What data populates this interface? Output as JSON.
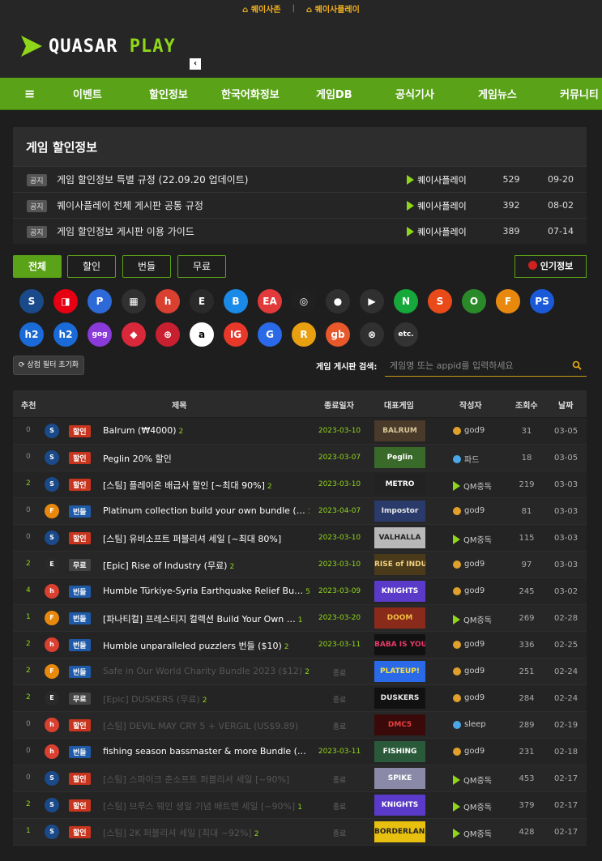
{
  "topbar": {
    "link1": "퀘이사존",
    "separator": "|",
    "link2": "퀘이사플레이"
  },
  "logo": {
    "text_a": "QUASAR ",
    "text_b": "PLAY",
    "collapse": "‹"
  },
  "nav": {
    "menu": "≡",
    "items": [
      "이벤트",
      "할인정보",
      "한국어화정보",
      "게임DB",
      "공식기사",
      "게임뉴스",
      "커뮤니티"
    ]
  },
  "board": {
    "title": "게임 할인정보"
  },
  "notices": [
    {
      "tag": "공지",
      "title": "게임 할인정보 특별 규정 (22.09.20 업데이트)",
      "author": "퀘이사플레이",
      "views": "529",
      "date": "09-20"
    },
    {
      "tag": "공지",
      "title": "퀘이사플레이 전체 게시판 공통 규정",
      "author": "퀘이사플레이",
      "views": "392",
      "date": "08-02"
    },
    {
      "tag": "공지",
      "title": "게임 할인정보 게시판 이용 가이드",
      "author": "퀘이사플레이",
      "views": "389",
      "date": "07-14"
    }
  ],
  "filters": {
    "all": "전체",
    "sale": "할인",
    "bundle": "번들",
    "free": "무료",
    "popular": "인기정보"
  },
  "platforms_row1": [
    {
      "icon": "steam-icon",
      "color": "#1b4a8a",
      "glyph": "S"
    },
    {
      "icon": "nintendo-icon",
      "color": "#e60012",
      "glyph": "◨"
    },
    {
      "icon": "ps-store-icon",
      "color": "#2d6ad8",
      "glyph": "P"
    },
    {
      "icon": "ms-store-icon",
      "color": "#303030",
      "glyph": "▦"
    },
    {
      "icon": "humble-icon",
      "color": "#d94030",
      "glyph": "h"
    },
    {
      "icon": "epic-icon",
      "color": "#2a2a2a",
      "glyph": "E"
    },
    {
      "icon": "battlenet-icon",
      "color": "#1a8ae8",
      "glyph": "B"
    },
    {
      "icon": "ea-icon",
      "color": "#e23a3a",
      "glyph": "EA"
    },
    {
      "icon": "ubisoft-icon",
      "color": "#202020",
      "glyph": "◎"
    },
    {
      "icon": "apple-icon",
      "color": "#303030",
      "glyph": "●"
    },
    {
      "icon": "google-play-icon",
      "color": "#303030",
      "glyph": "▶"
    },
    {
      "icon": "nexon-icon",
      "color": "#16a83a",
      "glyph": "N"
    },
    {
      "icon": "smilegate-icon",
      "color": "#e84a1a",
      "glyph": "S"
    },
    {
      "icon": "onestore-icon",
      "color": "#2a8a2a",
      "glyph": "O"
    },
    {
      "icon": "fanatical-icon",
      "color": "#e8890e",
      "glyph": "F"
    },
    {
      "icon": "ps-plus-icon",
      "color": "#1a5ad8",
      "glyph": "PS"
    }
  ],
  "platforms_row2": [
    {
      "icon": "h2-icon",
      "color": "#1a6ad8",
      "glyph": "h2"
    },
    {
      "icon": "h2-alt-icon",
      "color": "#1a6ad8",
      "glyph": "h2"
    },
    {
      "icon": "gog-icon",
      "color": "#8a3ad8",
      "glyph": "gog"
    },
    {
      "icon": "gamesplanet-icon",
      "color": "#d8283a",
      "glyph": "◆"
    },
    {
      "icon": "indiegala-icon",
      "color": "#c82030",
      "glyph": "⊕"
    },
    {
      "icon": "amazon-icon",
      "color": "#ffffff",
      "glyph": "a"
    },
    {
      "icon": "ig-icon",
      "color": "#e8382a",
      "glyph": "IG"
    },
    {
      "icon": "g-icon",
      "color": "#2a6ae8",
      "glyph": "G"
    },
    {
      "icon": "rockstar-icon",
      "color": "#e8a010",
      "glyph": "R"
    },
    {
      "icon": "gamesbillet-icon",
      "color": "#e8582a",
      "glyph": "gb"
    },
    {
      "icon": "gamersgate-icon",
      "color": "#303030",
      "glyph": "⊗"
    },
    {
      "icon": "etc-icon",
      "color": "#333333",
      "glyph": "etc."
    }
  ],
  "search": {
    "reset": "상점 필터 초기화",
    "label": "게임 게시판 검색:",
    "placeholder": "게임명 또는 appid를 입력하세요"
  },
  "table_head": [
    "추천",
    "제목",
    "종료일자",
    "대표게임",
    "작성자",
    "조회수",
    "날짜"
  ],
  "rows": [
    {
      "rec": "0",
      "platform": "steam",
      "cat": "할인",
      "catType": "sale",
      "title": "Balrum (₩4000)",
      "comments": "2",
      "end": "2023-03-10",
      "thumb": "BALRUM",
      "thumbBg": "#4a3a2a",
      "thumbFg": "#d8c898",
      "author": "god9",
      "avatar": "gold",
      "views": "31",
      "date": "03-05",
      "dim": false
    },
    {
      "rec": "0",
      "platform": "steam",
      "cat": "할인",
      "catType": "sale",
      "title": "Peglin 20% 할인",
      "comments": "",
      "end": "2023-03-07",
      "thumb": "Peglin",
      "thumbBg": "#3a6a2a",
      "thumbFg": "#ffffff",
      "author": "파드",
      "avatar": "blue",
      "views": "18",
      "date": "03-05",
      "dim": false
    },
    {
      "rec": "2",
      "platform": "steam",
      "cat": "할인",
      "catType": "sale",
      "title": "[스팀] 플레이온 배급사 할인 [~최대 90%]",
      "comments": "2",
      "end": "2023-03-10",
      "thumb": "METRO",
      "thumbBg": "#222222",
      "thumbFg": "#ffffff",
      "author": "QM중독",
      "avatar": "tri",
      "views": "219",
      "date": "03-03",
      "dim": false
    },
    {
      "rec": "0",
      "platform": "fanatical",
      "cat": "번들",
      "catType": "bun",
      "title": "Platinum collection build your own bundle (…",
      "comments": "1",
      "end": "2023-04-07",
      "thumb": "Impostor",
      "thumbBg": "#2a3a6a",
      "thumbFg": "#e8e8e8",
      "author": "god9",
      "avatar": "gold",
      "views": "81",
      "date": "03-03",
      "dim": false
    },
    {
      "rec": "0",
      "platform": "steam",
      "cat": "할인",
      "catType": "sale",
      "title": "[스팀] 유비소프트 퍼블리셔 세일 [~최대 80%]",
      "comments": "",
      "end": "2023-03-10",
      "thumb": "VALHALLA",
      "thumbBg": "#b8b8b8",
      "thumbFg": "#222222",
      "author": "QM중독",
      "avatar": "tri",
      "views": "115",
      "date": "03-03",
      "dim": false
    },
    {
      "rec": "2",
      "platform": "epic",
      "cat": "무료",
      "catType": "free",
      "title": "[Epic] Rise of Industry (무료)",
      "comments": "2",
      "end": "2023-03-10",
      "thumb": "RISE of INDUSTRY",
      "thumbBg": "#4a3a1a",
      "thumbFg": "#f0d080",
      "author": "god9",
      "avatar": "gold",
      "views": "97",
      "date": "03-03",
      "dim": false
    },
    {
      "rec": "4",
      "platform": "humble",
      "cat": "번들",
      "catType": "bun",
      "title": "Humble Türkiye-Syria Earthquake Relief Bu…",
      "comments": "5",
      "end": "2023-03-09",
      "thumb": "KNIGHTS",
      "thumbBg": "#5a3ac8",
      "thumbFg": "#ffffff",
      "author": "god9",
      "avatar": "gold",
      "views": "245",
      "date": "03-02",
      "dim": false
    },
    {
      "rec": "1",
      "platform": "fanatical",
      "cat": "번들",
      "catType": "bun",
      "title": "[파나티컬] 프레스티지 컬렉션 Build Your Own …",
      "comments": "1",
      "end": "2023-03-20",
      "thumb": "DOOM",
      "thumbBg": "#8a2a1a",
      "thumbFg": "#f0c040",
      "author": "QM중독",
      "avatar": "tri",
      "views": "269",
      "date": "02-28",
      "dim": false
    },
    {
      "rec": "2",
      "platform": "humble",
      "cat": "번들",
      "catType": "bun",
      "title": "Humble unparalleled puzzlers 번들 ($10)",
      "comments": "2",
      "end": "2023-03-11",
      "thumb": "BABA IS YOU",
      "thumbBg": "#111111",
      "thumbFg": "#e83a6a",
      "author": "god9",
      "avatar": "gold",
      "views": "336",
      "date": "02-25",
      "dim": false
    },
    {
      "rec": "2",
      "platform": "fanatical",
      "cat": "번들",
      "catType": "bun",
      "title": "Safe in Our World Charity Bundle 2023 ($12)",
      "comments": "2",
      "end": "종료",
      "thumb": "PLATEUP!",
      "thumbBg": "#2a6ae8",
      "thumbFg": "#f8e040",
      "author": "god9",
      "avatar": "gold",
      "views": "251",
      "date": "02-24",
      "dim": true
    },
    {
      "rec": "2",
      "platform": "epic",
      "cat": "무료",
      "catType": "free",
      "title": "[Epic] DUSKERS (무료)",
      "comments": "2",
      "end": "종료",
      "thumb": "DUSKERS",
      "thumbBg": "#111111",
      "thumbFg": "#e8e8e8",
      "author": "god9",
      "avatar": "gold",
      "views": "284",
      "date": "02-24",
      "dim": true
    },
    {
      "rec": "0",
      "platform": "humble",
      "cat": "할인",
      "catType": "sale",
      "title": "[스팀] DEVIL MAY CRY 5 + VERGIL (US$9.89)",
      "comments": "",
      "end": "종료",
      "thumb": "DMC5",
      "thumbBg": "#3a0a0a",
      "thumbFg": "#e84040",
      "author": "sleep",
      "avatar": "blue",
      "views": "289",
      "date": "02-19",
      "dim": true
    },
    {
      "rec": "0",
      "platform": "humble",
      "cat": "번들",
      "catType": "bun",
      "title": "fishing season bassmaster & more Bundle (…",
      "comments": "",
      "end": "2023-03-11",
      "thumb": "FISHING",
      "thumbBg": "#2a5a3a",
      "thumbFg": "#ffffff",
      "author": "god9",
      "avatar": "gold",
      "views": "231",
      "date": "02-18",
      "dim": false
    },
    {
      "rec": "0",
      "platform": "steam",
      "cat": "할인",
      "catType": "sale",
      "title": "[스팀] 스파이크 춘소프트 퍼블리셔 세일 [~90%]",
      "comments": "",
      "end": "종료",
      "thumb": "SPIKE",
      "thumbBg": "#8a8aa8",
      "thumbFg": "#ffffff",
      "author": "QM중독",
      "avatar": "tri",
      "views": "453",
      "date": "02-17",
      "dim": true
    },
    {
      "rec": "2",
      "platform": "steam",
      "cat": "할인",
      "catType": "sale",
      "title": "[스팀] 브루스 웨인 생일 기념 배트맨 세일 [~90%]",
      "comments": "1",
      "end": "종료",
      "thumb": "KNIGHTS",
      "thumbBg": "#5a3ac8",
      "thumbFg": "#ffffff",
      "author": "QM중독",
      "avatar": "tri",
      "views": "379",
      "date": "02-17",
      "dim": true
    },
    {
      "rec": "1",
      "platform": "steam",
      "cat": "할인",
      "catType": "sale",
      "title": "[스팀] 2K 퍼블리셔 세일 [최대 ~92%]",
      "comments": "2",
      "end": "종료",
      "thumb": "BORDERLANDS",
      "thumbBg": "#e8c010",
      "thumbFg": "#222222",
      "author": "QM중독",
      "avatar": "tri",
      "views": "428",
      "date": "02-17",
      "dim": true
    }
  ]
}
